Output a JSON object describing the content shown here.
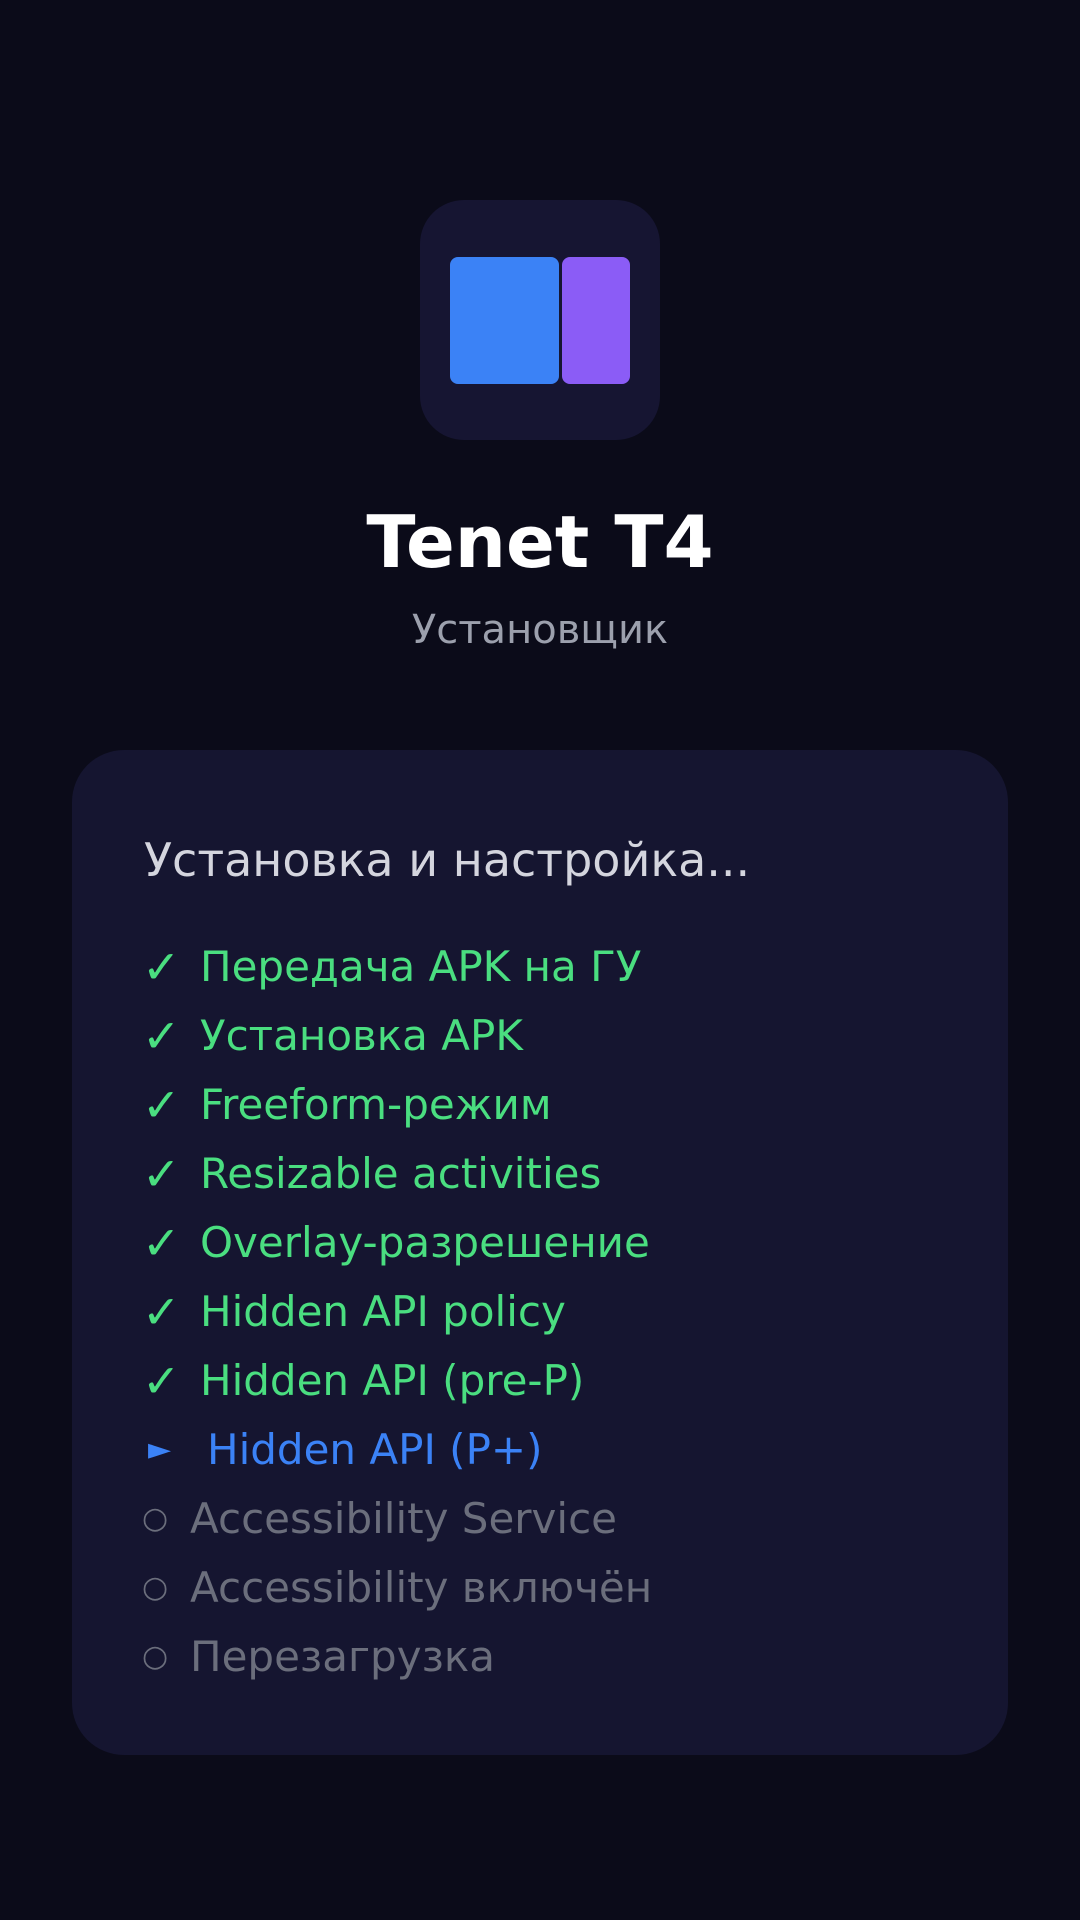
{
  "app": {
    "title": "Tenet T4",
    "subtitle": "Установщик"
  },
  "card": {
    "heading": "Установка и настройка..."
  },
  "steps": [
    {
      "label": "Передача APK на ГУ",
      "status": "done",
      "mark": "✓"
    },
    {
      "label": "Установка APK",
      "status": "done",
      "mark": "✓"
    },
    {
      "label": "Freeform-режим",
      "status": "done",
      "mark": "✓"
    },
    {
      "label": "Resizable activities",
      "status": "done",
      "mark": "✓"
    },
    {
      "label": "Overlay-разрешение",
      "status": "done",
      "mark": "✓"
    },
    {
      "label": "Hidden API policy",
      "status": "done",
      "mark": "✓"
    },
    {
      "label": "Hidden API (pre-P)",
      "status": "done",
      "mark": "✓"
    },
    {
      "label": "Hidden API (P+)",
      "status": "active",
      "mark": "►"
    },
    {
      "label": "Accessibility Service",
      "status": "pending",
      "mark": "○"
    },
    {
      "label": "Accessibility включён",
      "status": "pending",
      "mark": "○"
    },
    {
      "label": "Перезагрузка",
      "status": "pending",
      "mark": "○"
    }
  ],
  "colors": {
    "background": "#0b0b19",
    "card": "#151530",
    "done": "#4ade80",
    "active": "#3b82f6",
    "pending": "#6b6e7c",
    "icon_left": "#3b82f6",
    "icon_right": "#8b5cf6"
  }
}
